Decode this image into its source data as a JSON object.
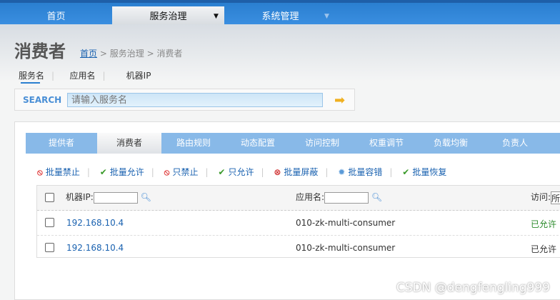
{
  "nav": {
    "items": [
      {
        "label": "首页"
      },
      {
        "label": "服务治理"
      },
      {
        "label": "系统管理"
      }
    ]
  },
  "page": {
    "title": "消费者",
    "breadcrumb": {
      "home": "首页",
      "sep": ">",
      "section": "服务治理",
      "current": "消费者"
    }
  },
  "search": {
    "tabs": [
      "服务名",
      "应用名",
      "机器IP"
    ],
    "label": "SEARCH",
    "placeholder": "请输入服务名"
  },
  "tabs": [
    "提供者",
    "消费者",
    "路由规则",
    "动态配置",
    "访问控制",
    "权重调节",
    "负载均衡",
    "负责人"
  ],
  "actions": [
    "批量禁止",
    "批量允许",
    "只禁止",
    "只允许",
    "批量屏蔽",
    "批量容错",
    "批量恢复"
  ],
  "table": {
    "filters": {
      "ip": "机器IP:",
      "app": "应用名:",
      "access": "访问:",
      "access_value": "所"
    },
    "rows": [
      {
        "ip": "192.168.10.4",
        "app": "010-zk-multi-consumer",
        "status": "已允许"
      },
      {
        "ip": "192.168.10.4",
        "app": "010-zk-multi-consumer",
        "status": "已允许"
      }
    ]
  },
  "watermark": "CSDN @dengfengling999"
}
